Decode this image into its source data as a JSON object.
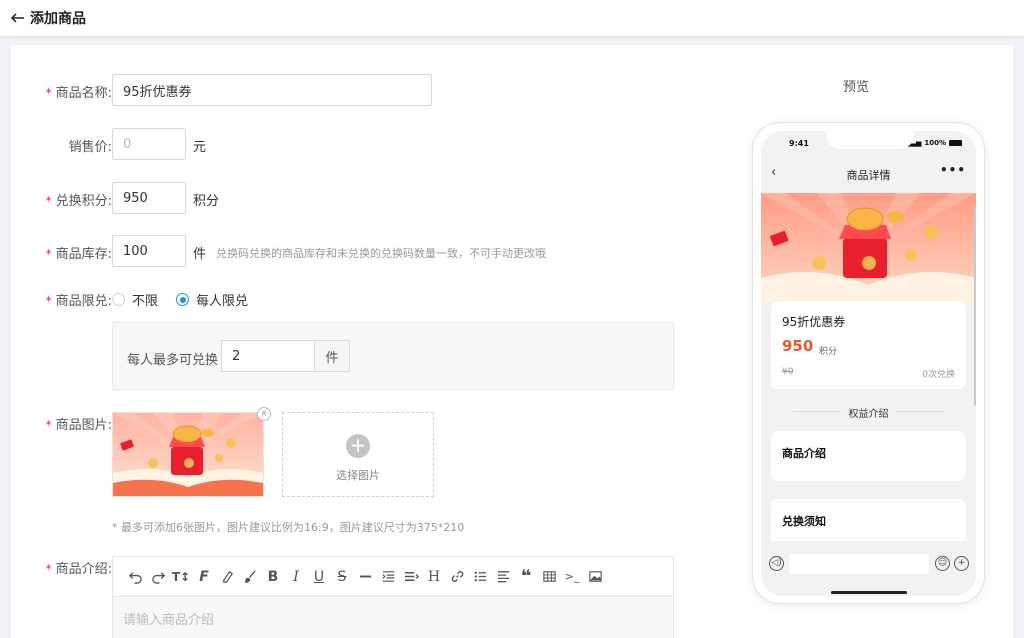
{
  "header": {
    "title": "添加商品"
  },
  "form": {
    "name": {
      "label": "商品名称:",
      "value": "95折优惠券"
    },
    "price": {
      "label": "销售价:",
      "placeholder": "0",
      "unit": "元"
    },
    "points": {
      "label": "兑换积分:",
      "value": "950",
      "unit": "积分"
    },
    "stock": {
      "label": "商品库存:",
      "value": "100",
      "unit": "件",
      "hint": "兑换码兑换的商品库存和未兑换的兑换码数量一致，不可手动更改哦"
    },
    "limit": {
      "label": "商品限兑:",
      "options": [
        "不限",
        "每人限兑"
      ],
      "selected": "每人限兑",
      "per_person_label": "每人最多可兑换",
      "per_person_value": "2",
      "per_person_unit": "件"
    },
    "images": {
      "label": "商品图片:",
      "upload_label": "选择图片",
      "hint": "* 最多可添加6张图片，图片建议比例为16:9，图片建议尺寸为375*210"
    },
    "intro": {
      "label": "商品介绍:",
      "placeholder": "请输入商品介绍",
      "toolbar_icons": [
        "undo-icon",
        "redo-icon",
        "font-size-icon",
        "font-family-icon",
        "highlight-icon",
        "brush-icon",
        "bold-icon",
        "italic-icon",
        "underline-icon",
        "strikethrough-icon",
        "horizontal-rule-icon",
        "indent-icon",
        "line-height-icon",
        "heading-icon",
        "link-icon",
        "list-icon",
        "align-icon",
        "quote-icon",
        "table-icon",
        "code-icon",
        "image-icon"
      ]
    }
  },
  "preview": {
    "title": "预览",
    "status_time": "9:41",
    "battery": "100%",
    "nav_title": "商品详情",
    "product_name": "95折优惠券",
    "points": "950",
    "points_unit": "积分",
    "original_price": "¥0",
    "redeem_count": "0次兑换",
    "section_title": "权益介绍",
    "intro_heading": "商品介绍",
    "notice_heading": "兑换须知"
  },
  "colors": {
    "accent": "#1890ff",
    "required": "#f5222d",
    "points": "#f0562d"
  }
}
